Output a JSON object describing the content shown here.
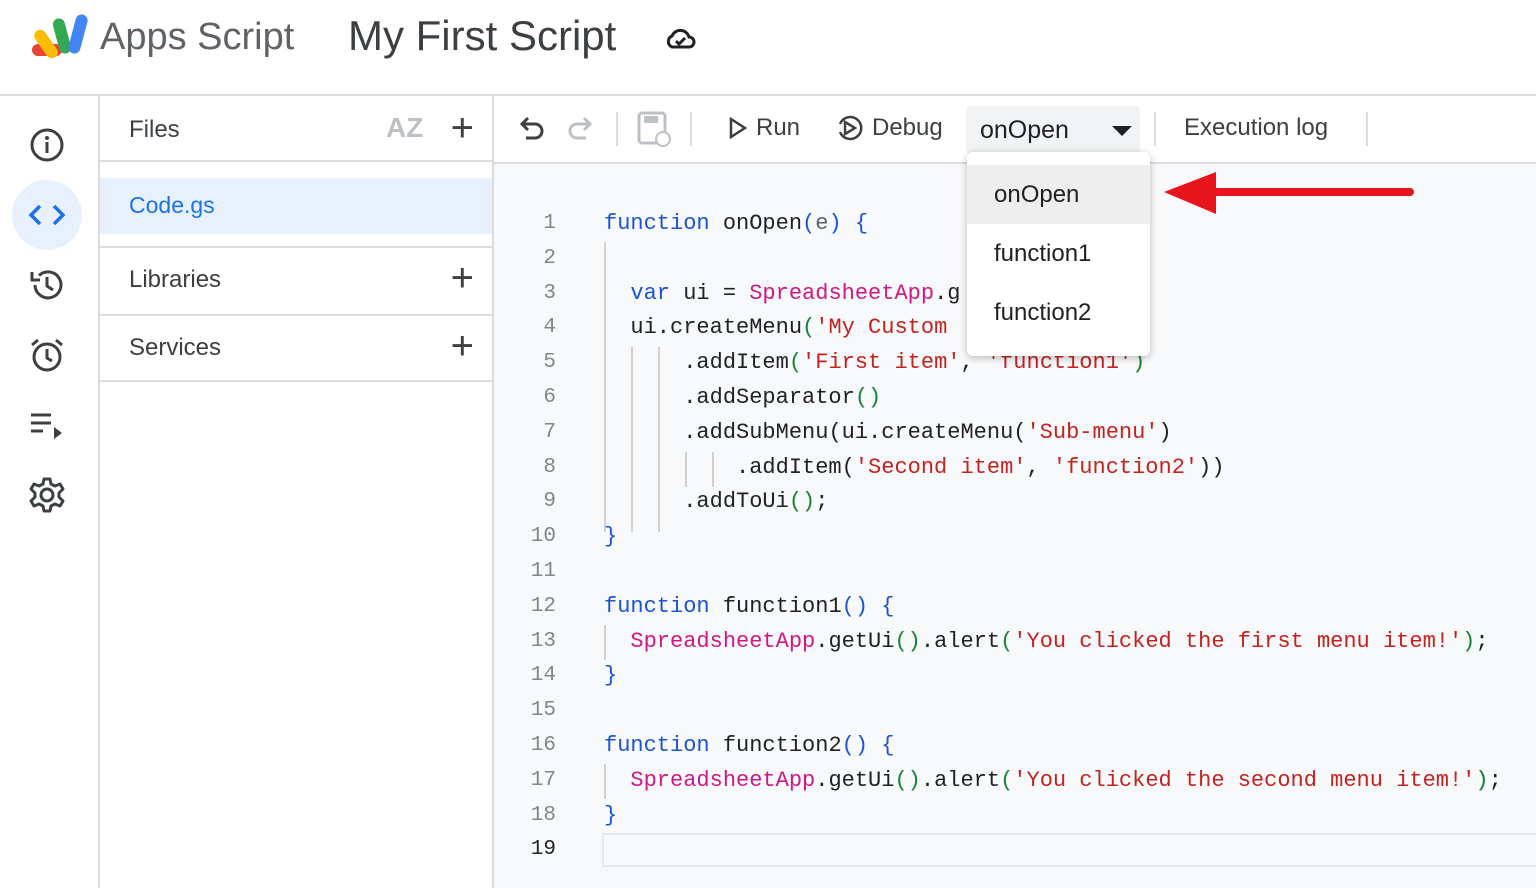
{
  "header": {
    "app_name": "Apps Script",
    "project_title": "My First Script",
    "save_status_icon": "cloud-check-icon"
  },
  "rail": {
    "items": [
      {
        "icon": "info-icon"
      },
      {
        "icon": "code-icon",
        "active": true
      },
      {
        "icon": "history-icon"
      },
      {
        "icon": "alarm-icon"
      },
      {
        "icon": "executions-icon"
      },
      {
        "icon": "settings-icon"
      }
    ]
  },
  "files_panel": {
    "files_label": "Files",
    "sort_label": "AZ",
    "file": "Code.gs",
    "libraries_label": "Libraries",
    "services_label": "Services"
  },
  "toolbar": {
    "run": "Run",
    "debug": "Debug",
    "function_select": "onOpen",
    "execution_log": "Execution log"
  },
  "function_menu": {
    "options": [
      "onOpen",
      "function1",
      "function2"
    ],
    "selected": "onOpen"
  },
  "colors": {
    "accent": "#1a73e8",
    "keyword": "#1a53d6",
    "string": "#c5221f",
    "class": "#d01884",
    "arrow": "#e8141b"
  },
  "editor": {
    "line_numbers": [
      "1",
      "2",
      "3",
      "4",
      "5",
      "6",
      "7",
      "8",
      "9",
      "10",
      "11",
      "12",
      "13",
      "14",
      "15",
      "16",
      "17",
      "18",
      "19"
    ],
    "current_line": 19,
    "lines": [
      [
        [
          "k",
          "function"
        ],
        [
          "t",
          " onOpen"
        ],
        [
          "b",
          "("
        ],
        [
          "p",
          "e"
        ],
        [
          "b",
          ")"
        ],
        [
          "t",
          " "
        ],
        [
          "b",
          "{"
        ]
      ],
      [],
      [
        [
          "t",
          "  "
        ],
        [
          "k",
          "var"
        ],
        [
          "t",
          " ui = "
        ],
        [
          "c",
          "SpreadsheetApp"
        ],
        [
          "t",
          ".g"
        ]
      ],
      [
        [
          "t",
          "  ui.createMenu"
        ],
        [
          "g",
          "("
        ],
        [
          "s",
          "'My Custom"
        ]
      ],
      [
        [
          "t",
          "      .addItem"
        ],
        [
          "g",
          "("
        ],
        [
          "s",
          "'First item'"
        ],
        [
          "t",
          ", "
        ],
        [
          "s",
          "'function1'"
        ],
        [
          "g",
          ")"
        ]
      ],
      [
        [
          "t",
          "      .addSeparator"
        ],
        [
          "g",
          "()"
        ]
      ],
      [
        [
          "t",
          "      .addSubMenu"
        ],
        [
          "t",
          "(ui.createMenu"
        ],
        [
          "t",
          "("
        ],
        [
          "s",
          "'Sub-menu'"
        ],
        [
          "t",
          ")"
        ]
      ],
      [
        [
          "t",
          "          .addItem"
        ],
        [
          "t",
          "("
        ],
        [
          "s",
          "'Second item'"
        ],
        [
          "t",
          ", "
        ],
        [
          "s",
          "'function2'"
        ],
        [
          "t",
          "))"
        ]
      ],
      [
        [
          "t",
          "      .addToUi"
        ],
        [
          "g",
          "()"
        ],
        [
          "t",
          ";"
        ]
      ],
      [
        [
          "b",
          "}"
        ]
      ],
      [],
      [
        [
          "k",
          "function"
        ],
        [
          "t",
          " function1"
        ],
        [
          "b",
          "()"
        ],
        [
          "t",
          " "
        ],
        [
          "b",
          "{"
        ]
      ],
      [
        [
          "t",
          "  "
        ],
        [
          "c",
          "SpreadsheetApp"
        ],
        [
          "t",
          ".getUi"
        ],
        [
          "g",
          "()"
        ],
        [
          "t",
          ".alert"
        ],
        [
          "g",
          "("
        ],
        [
          "s",
          "'You clicked the first menu item!'"
        ],
        [
          "g",
          ")"
        ],
        [
          "t",
          ";"
        ]
      ],
      [
        [
          "b",
          "}"
        ]
      ],
      [],
      [
        [
          "k",
          "function"
        ],
        [
          "t",
          " function2"
        ],
        [
          "b",
          "()"
        ],
        [
          "t",
          " "
        ],
        [
          "b",
          "{"
        ]
      ],
      [
        [
          "t",
          "  "
        ],
        [
          "c",
          "SpreadsheetApp"
        ],
        [
          "t",
          ".getUi"
        ],
        [
          "g",
          "()"
        ],
        [
          "t",
          ".alert"
        ],
        [
          "g",
          "("
        ],
        [
          "s",
          "'You clicked the second menu item!'"
        ],
        [
          "g",
          ")"
        ],
        [
          "t",
          ";"
        ]
      ],
      [
        [
          "b",
          "}"
        ]
      ],
      []
    ]
  }
}
